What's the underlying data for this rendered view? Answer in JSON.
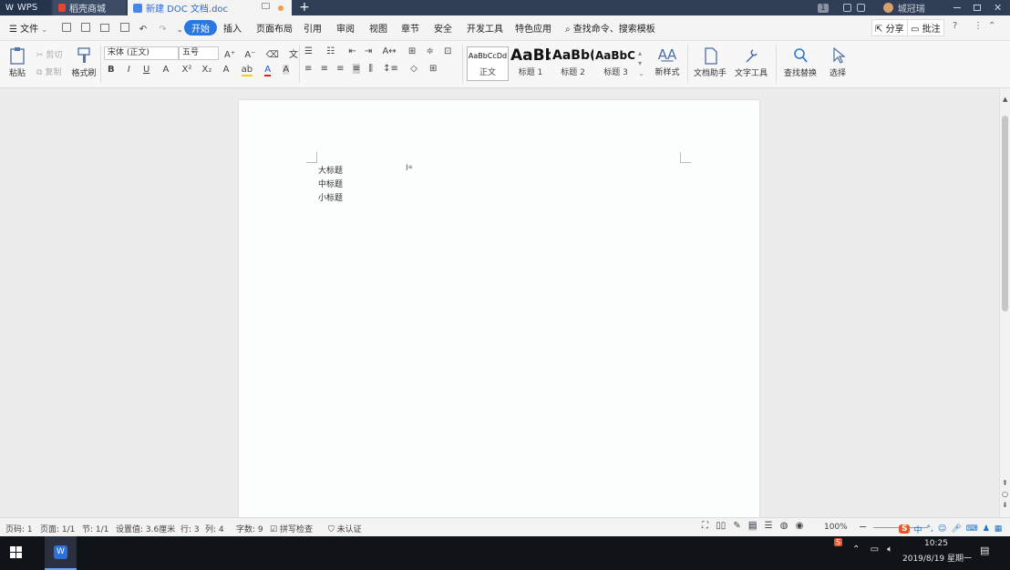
{
  "titlebar": {
    "tabs": [
      {
        "label": "WPS"
      },
      {
        "label": "稻壳商城"
      },
      {
        "label": "新建 DOC 文档.doc"
      }
    ],
    "user_name": "城冠瑞",
    "page_badge": "1"
  },
  "menu": {
    "file_label": "文件",
    "items": [
      "开始",
      "插入",
      "页面布局",
      "引用",
      "审阅",
      "视图",
      "章节",
      "安全",
      "开发工具",
      "特色应用"
    ],
    "search_placeholder": "查找命令、搜索模板",
    "share_label": "分享",
    "comment_label": "批注"
  },
  "ribbon": {
    "paste_label": "粘贴",
    "cut_label": "剪切",
    "copy_label": "复制",
    "format_painter_label": "格式刷",
    "font_name": "宋体 (正文)",
    "font_size": "五号",
    "styles": [
      {
        "preview": "AaBbCcDd",
        "label": "正文"
      },
      {
        "preview": "AaBb",
        "label": "标题 1"
      },
      {
        "preview": "AaBb(",
        "label": "标题 2"
      },
      {
        "preview": "AaBbC(",
        "label": "标题 3"
      }
    ],
    "new_style_label": "新样式",
    "doc_assistant_label": "文档助手",
    "text_tools_label": "文字工具",
    "find_replace_label": "查找替换",
    "select_label": "选择"
  },
  "document": {
    "lines": [
      "大标题",
      "中标题",
      "小标题"
    ]
  },
  "statusbar": {
    "page_no": "页码: 1",
    "pages": "页面: 1/1",
    "section": "节: 1/1",
    "setting": "设置值: 3.6厘米",
    "row": "行: 3",
    "col": "列: 4",
    "word_count": "字数: 9",
    "spell_check": "拼写检查",
    "unverified": "未认证",
    "zoom": "100%"
  },
  "taskbar": {
    "time": "10:25",
    "date": "2019/8/19 星期一",
    "ime": "中"
  },
  "colors": {
    "accent": "#2a77e0",
    "titlebar": "#2f3e55",
    "taskbar": "#101318"
  }
}
